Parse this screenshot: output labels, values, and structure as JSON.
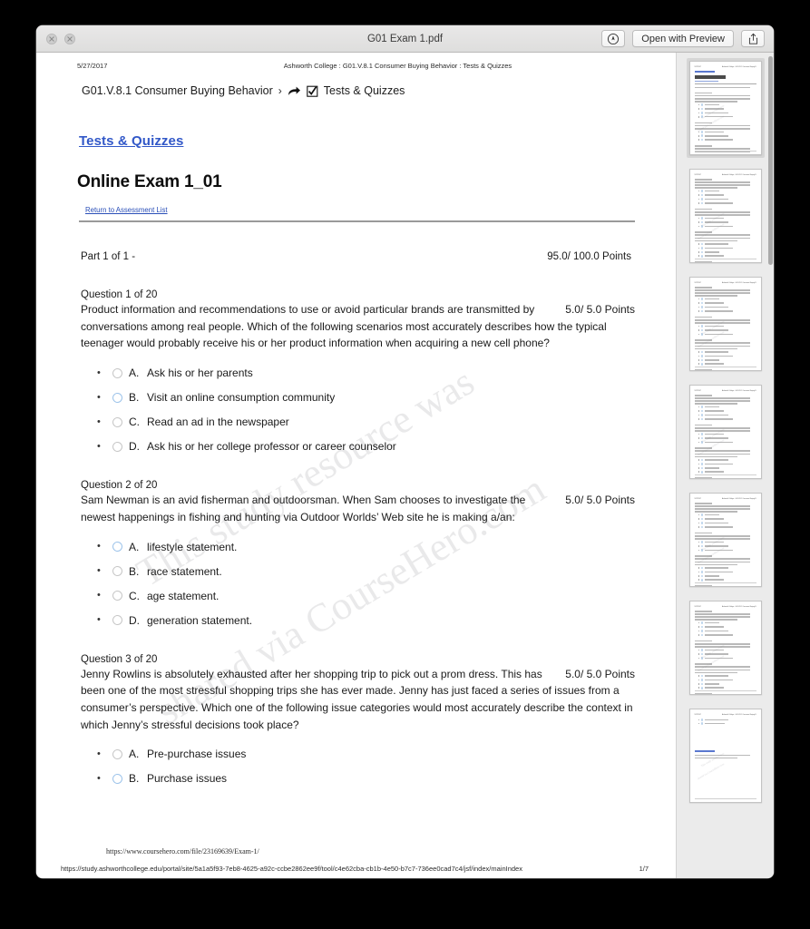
{
  "window": {
    "title": "G01 Exam 1.pdf",
    "toolbar": {
      "markup_icon": "markup-pen-circle-icon",
      "open_with_preview_label": "Open with Preview",
      "share_icon": "share-icon"
    },
    "traffic_lights": [
      "close-button",
      "minimize-button"
    ]
  },
  "document": {
    "running_head": {
      "date": "5/27/2017",
      "title": "Ashworth College : G01.V.8.1 Consumer Buying Behavior : Tests & Quizzes"
    },
    "breadcrumb": {
      "course": "G01.V.8.1 Consumer Buying Behavior",
      "chevron": "›",
      "section": "Tests & Quizzes"
    },
    "section_link": "Tests & Quizzes",
    "exam_title": "Online Exam 1_01",
    "return_link": "Return to Assessment List",
    "part_label": "Part 1 of 1 -",
    "part_score": "95.0/ 100.0 Points",
    "watermark": {
      "line1": "This study resource was",
      "line2": "shared via CourseHero.com"
    },
    "questions": [
      {
        "label": "Question 1 of 20",
        "text": "Product information and recommendations to use or avoid particular brands are transmitted by conversations among real people. Which of the following scenarios most accurately describes how the typical teenager would probably receive his or her product information when acquiring a new cell phone?",
        "points": "5.0/ 5.0 Points",
        "options": [
          {
            "letter": "A.",
            "text": "Ask his or her parents",
            "highlighted": false
          },
          {
            "letter": "B.",
            "text": "Visit an online consumption community",
            "highlighted": true
          },
          {
            "letter": "C.",
            "text": "Read an ad in the newspaper",
            "highlighted": false
          },
          {
            "letter": "D.",
            "text": "Ask his or her college professor or career counselor",
            "highlighted": false
          }
        ]
      },
      {
        "label": "Question 2 of 20",
        "text": "Sam Newman is an avid fisherman and outdoorsman. When Sam chooses to investigate the newest happenings in fishing and hunting via Outdoor Worlds’ Web site he is making a/an:",
        "points": "5.0/ 5.0 Points",
        "options": [
          {
            "letter": "A.",
            "text": "lifestyle statement.",
            "highlighted": true
          },
          {
            "letter": "B.",
            "text": "race statement.",
            "highlighted": false
          },
          {
            "letter": "C.",
            "text": "age statement.",
            "highlighted": false
          },
          {
            "letter": "D.",
            "text": "generation statement.",
            "highlighted": false
          }
        ]
      },
      {
        "label": "Question 3 of 20",
        "text": "Jenny Rowlins is absolutely exhausted after her shopping trip to pick out a prom dress. This has been one of the most stressful shopping trips she has ever made. Jenny has just faced a series of issues from a consumer’s perspective. Which one of the following issue categories would most accurately describe the context in which Jenny’s stressful decisions took place?",
        "points": "5.0/ 5.0 Points",
        "options": [
          {
            "letter": "A.",
            "text": "Pre-purchase issues",
            "highlighted": false
          },
          {
            "letter": "B.",
            "text": "Purchase issues",
            "highlighted": true
          }
        ]
      }
    ],
    "coursehero_url": "https://www.coursehero.com/file/23169639/Exam-1/",
    "footer_url": "https://study.ashworthcollege.edu/portal/site/5a1a5f93-7eb8-4625-a92c-ccbe2862ee9f/tool/c4e62cba-cb1b-4e50-b7c7-736ee0cad7c4/jsf/index/mainIndex",
    "footer_page": "1/7"
  },
  "thumbnails": {
    "count": 7,
    "selected_index": 0
  },
  "colors": {
    "link_blue": "#3258c8",
    "small_link_blue": "#2a4fb8",
    "radio_highlight": "#9cc3ea",
    "sidebar_bg": "#ebebeb",
    "titlebar_bg": "#e4e3e3"
  }
}
